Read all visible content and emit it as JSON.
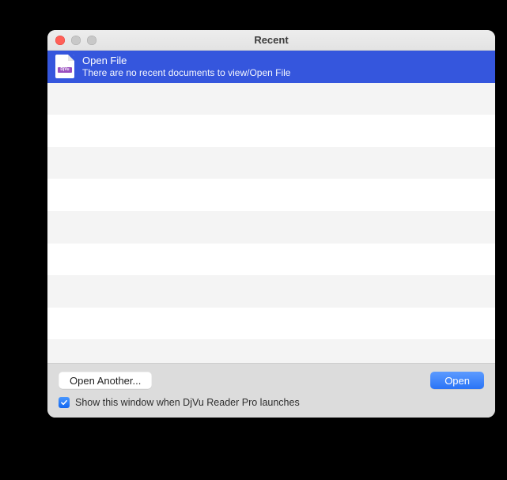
{
  "window": {
    "title": "Recent"
  },
  "selection": {
    "icon_band_text": "DjVu",
    "title": "Open File",
    "subtitle": "There are no recent documents to view/Open File"
  },
  "footer": {
    "open_another_label": "Open Another...",
    "open_label": "Open",
    "checkbox_checked": true,
    "checkbox_label": "Show this window when DjVu Reader Pro launches"
  }
}
